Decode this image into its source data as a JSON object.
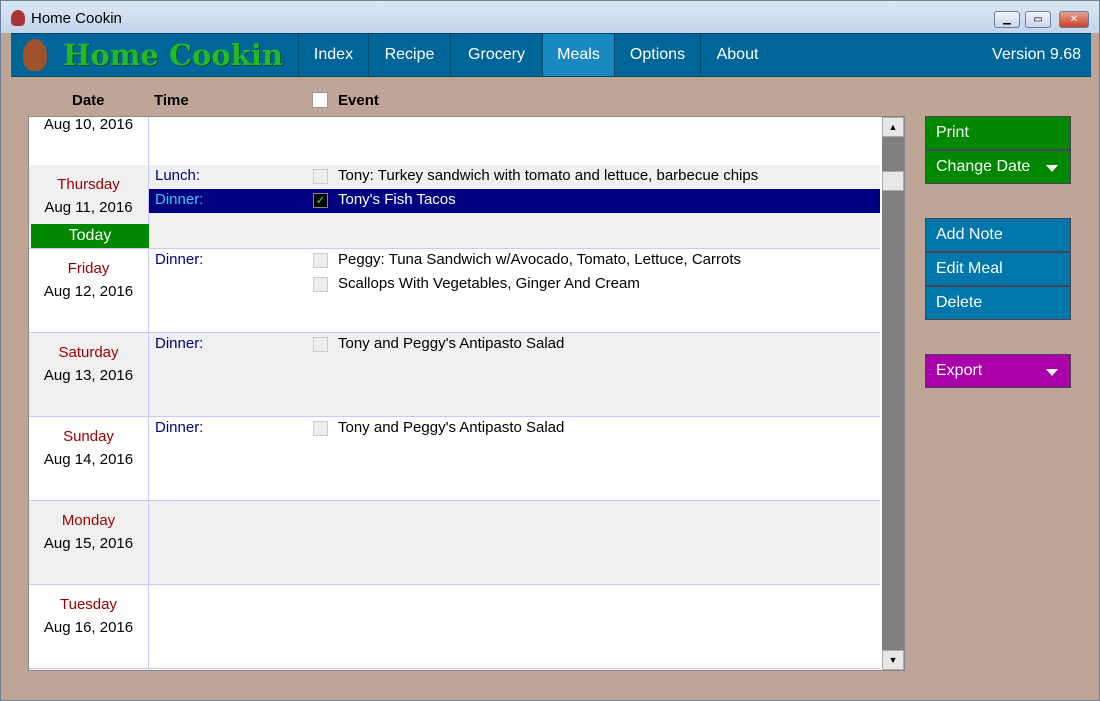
{
  "window": {
    "title": "Home Cookin"
  },
  "header": {
    "logo": "Home Cookin",
    "version": "Version 9.68",
    "nav": [
      {
        "label": "Index"
      },
      {
        "label": "Recipe"
      },
      {
        "label": "Grocery"
      },
      {
        "label": "Meals",
        "active": true
      },
      {
        "label": "Options"
      },
      {
        "label": "About"
      }
    ]
  },
  "columns": {
    "date": "Date",
    "time": "Time",
    "event": "Event"
  },
  "days": [
    {
      "day": "",
      "date": "Aug 10, 2016",
      "meals": []
    },
    {
      "day": "Thursday",
      "date": "Aug 11, 2016",
      "today": "Today",
      "meals": [
        {
          "time": "Lunch:",
          "items": [
            "Tony: Turkey sandwich with tomato and lettuce, barbecue chips"
          ]
        },
        {
          "time": "Dinner:",
          "items": [
            "Tony's Fish Tacos"
          ],
          "selected": true,
          "checked": true
        }
      ]
    },
    {
      "day": "Friday",
      "date": "Aug 12, 2016",
      "meals": [
        {
          "time": "Dinner:",
          "items": [
            "Peggy: Tuna Sandwich w/Avocado, Tomato, Lettuce, Carrots",
            "Scallops With Vegetables, Ginger And Cream"
          ]
        }
      ]
    },
    {
      "day": "Saturday",
      "date": "Aug 13, 2016",
      "meals": [
        {
          "time": "Dinner:",
          "items": [
            "Tony and Peggy's Antipasto Salad"
          ]
        }
      ]
    },
    {
      "day": "Sunday",
      "date": "Aug 14, 2016",
      "meals": [
        {
          "time": "Dinner:",
          "items": [
            "Tony and Peggy's Antipasto Salad"
          ]
        }
      ]
    },
    {
      "day": "Monday",
      "date": "Aug 15, 2016",
      "meals": []
    },
    {
      "day": "Tuesday",
      "date": "Aug 16, 2016",
      "meals": []
    }
  ],
  "buttons": {
    "print": "Print",
    "change_date": "Change Date",
    "add_note": "Add Note",
    "edit_meal": "Edit Meal",
    "delete": "Delete",
    "export": "Export"
  },
  "colors": {
    "green": "#008800",
    "blue": "#0077aa",
    "purple": "#aa00aa",
    "header": "#006699",
    "selection": "#000080"
  }
}
